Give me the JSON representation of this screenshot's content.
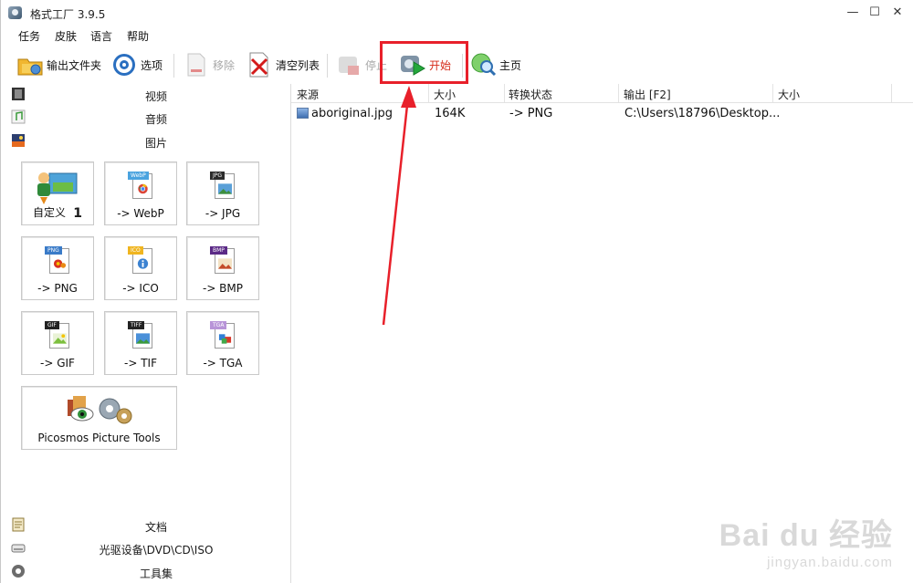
{
  "window": {
    "title": "格式工厂 3.9.5"
  },
  "menu": [
    "任务",
    "皮肤",
    "语言",
    "帮助"
  ],
  "toolbar": {
    "output_folder": "输出文件夹",
    "options": "选项",
    "remove": "移除",
    "clear_list": "清空列表",
    "stop": "停止",
    "start": "开始",
    "home": "主页"
  },
  "sidebar": {
    "categories_top": [
      "视频",
      "音频",
      "图片"
    ],
    "tiles": [
      {
        "label": "自定义",
        "badge": "1"
      },
      {
        "label": "-> WebP",
        "tag": "WebP"
      },
      {
        "label": "-> JPG",
        "tag": "JPG"
      },
      {
        "label": "-> PNG",
        "tag": "PNG"
      },
      {
        "label": "-> ICO",
        "tag": "ICO"
      },
      {
        "label": "-> BMP",
        "tag": "BMP"
      },
      {
        "label": "-> GIF",
        "tag": "GIF"
      },
      {
        "label": "-> TIF",
        "tag": "TIFF"
      },
      {
        "label": "-> TGA",
        "tag": "TGA"
      },
      {
        "label": "Picosmos Picture Tools"
      }
    ],
    "categories_bottom": [
      "文档",
      "光驱设备\\DVD\\CD\\ISO",
      "工具集"
    ]
  },
  "filelist": {
    "columns": [
      "来源",
      "大小",
      "转换状态",
      "输出 [F2]",
      "大小"
    ],
    "rows": [
      {
        "source": "aboriginal.jpg",
        "size": "164K",
        "status": "-> PNG",
        "output": "C:\\Users\\18796\\Desktop...",
        "out_size": ""
      }
    ]
  },
  "watermark": {
    "brand": "Bai du 经验",
    "url": "jingyan.baidu.com"
  },
  "colors": {
    "highlight": "#e8202a",
    "accent_text": "#d62a18"
  }
}
